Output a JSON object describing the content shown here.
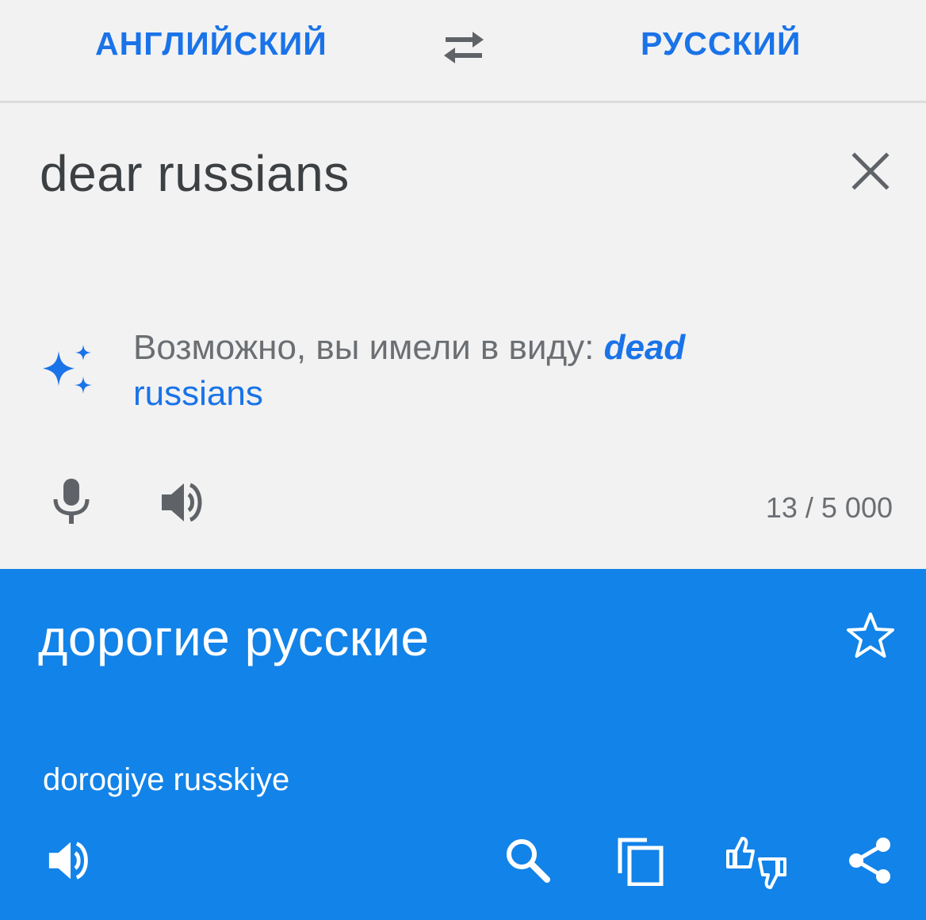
{
  "language_bar": {
    "source_language": "АНГЛИЙСКИЙ",
    "target_language": "РУССКИЙ",
    "swap_icon": "swap-arrows-icon"
  },
  "source": {
    "text": "dear russians",
    "clear_icon": "close-icon",
    "suggestion": {
      "prefix": "Возможно, вы имели в виду: ",
      "emphasized": "dead",
      "rest": " russians"
    },
    "counter": "13 / 5 000"
  },
  "result": {
    "text": "дорогие русские",
    "transliteration": "dorogiye russkiye"
  },
  "colors": {
    "accent": "#1a73e8",
    "result_background": "#1283e8",
    "page_background": "#f2f2f2",
    "muted_text": "#6b6f73"
  }
}
